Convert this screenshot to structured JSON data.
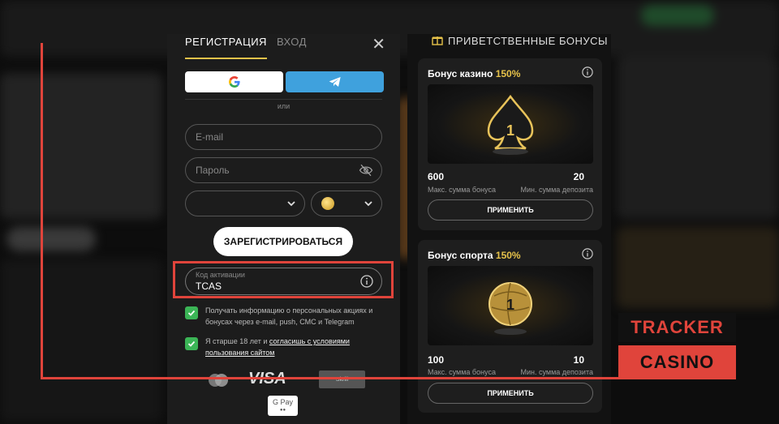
{
  "tabs": {
    "register": "РЕГИСТРАЦИЯ",
    "login": "ВХОД"
  },
  "divider_text": "или",
  "form": {
    "email_placeholder": "E-mail",
    "password_placeholder": "Пароль",
    "submit_label": "ЗАРЕГИСТРИРОВАТЬСЯ",
    "promo_label": "Код активации",
    "promo_value": "TCAS"
  },
  "consents": [
    {
      "text": "Получать информацию о персональных акциях и бонусах через e-mail, push, СМС и Telegram",
      "checked": true
    },
    {
      "text": "Я старше 18 лет и ",
      "link": "согласишь с условиями пользования сайтом",
      "checked": true
    }
  ],
  "payments": {
    "visa": "VISA",
    "skrill": "Skrill",
    "gpay": "G Pay"
  },
  "bonuses": {
    "header": "ПРИВЕТСТВЕННЫЕ БОНУСЫ",
    "cards": [
      {
        "title": "Бонус казино",
        "percent": "150%",
        "max_value": "600",
        "max_label": "Макс. сумма бонуса",
        "min_value": "20",
        "min_label": "Мин. сумма депозита",
        "apply_label": "ПРИМЕНИТЬ",
        "icon": "spade-trophy-icon"
      },
      {
        "title": "Бонус спорта",
        "percent": "150%",
        "max_value": "100",
        "max_label": "Макс. сумма бонуса",
        "min_value": "10",
        "min_label": "Мин. сумма депозита",
        "apply_label": "ПРИМЕНИТЬ",
        "icon": "ball-trophy-icon"
      }
    ]
  },
  "watermark": {
    "line1": "TRACKER",
    "line2": "CASINO"
  },
  "colors": {
    "accent": "#e6c24a",
    "telegram": "#3fa1dd",
    "check": "#3bb556",
    "highlight": "#e0443b"
  }
}
